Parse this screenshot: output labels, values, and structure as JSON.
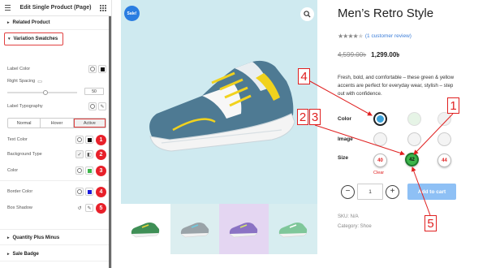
{
  "panel": {
    "title": "Edit Single Product (Page)",
    "sections": {
      "related": "Related Product",
      "variation": "Variation Swatches",
      "quantity": "Quantity Plus Minus",
      "sale_badge": "Sale Badge"
    },
    "fields": {
      "label_color": "Label Color",
      "right_spacing": "Right Spacing",
      "right_spacing_value": "50",
      "label_typography": "Label Typography",
      "text_color": "Text Color",
      "background_type": "Background Type",
      "color": "Color",
      "border_color": "Border Color",
      "box_shadow": "Box Shadow"
    },
    "state_tabs": [
      "Normal",
      "Hover",
      "Active"
    ],
    "active_tab": "Active",
    "badges": [
      "1",
      "2",
      "3",
      "4",
      "5"
    ],
    "swatch_colors": {
      "text_color": "#111111",
      "color": "#3cb54a",
      "border_color": "#1a1adc"
    }
  },
  "product": {
    "sale_badge": "Sale!",
    "title": "Men’s Retro Style",
    "rating_out_of_5": 4,
    "review_link": "(1 customer review)",
    "old_price": "4,599.00৳",
    "new_price": "1,299.00৳",
    "description": "Fresh, bold, and comfortable – these green & yellow accents are perfect for everyday wear, stylish – step out with confidence.",
    "color_label": "Color",
    "image_label": "Image",
    "size_label": "Size",
    "sizes": [
      "40",
      "42",
      "44"
    ],
    "selected_size": "42",
    "clear_label": "Clear",
    "quantity": "1",
    "add_to_cart": "Add to cart",
    "sku": "SKU: N/A",
    "category": "Category: Shoe",
    "accent_colors": {
      "sale": "#2a7de1",
      "selected_size": "#3cb54a",
      "size_text": "#e02020",
      "callout": "#e02020"
    }
  },
  "callouts": [
    "4",
    "2",
    "3",
    "1",
    "5"
  ]
}
